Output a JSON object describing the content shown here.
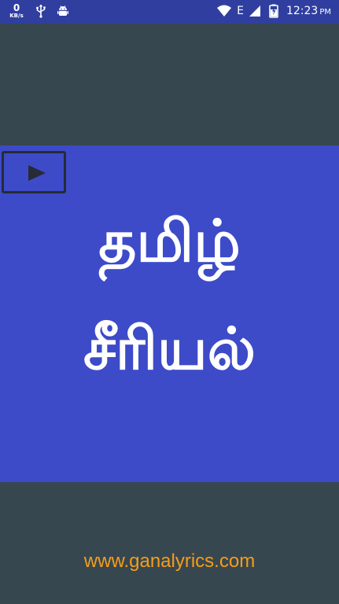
{
  "status_bar": {
    "speed_value": "0",
    "speed_unit": "KB/s",
    "network_type": "E",
    "time": "12:23",
    "ampm": "PM",
    "left_icons": [
      "usb-icon",
      "android-debug-icon"
    ],
    "right_icons": [
      "wifi-icon",
      "signal-icon",
      "battery-charging-icon"
    ]
  },
  "banner": {
    "background_color": "#3d4bc9",
    "play_icon": "play-icon",
    "title_line1": "தமிழ்",
    "title_line2": "சீரியல்"
  },
  "footer": {
    "link_text": "www.ganalyrics.com",
    "link_color": "#f59d1a"
  },
  "colors": {
    "status_bar": "#303f9f",
    "background": "#37474f"
  }
}
